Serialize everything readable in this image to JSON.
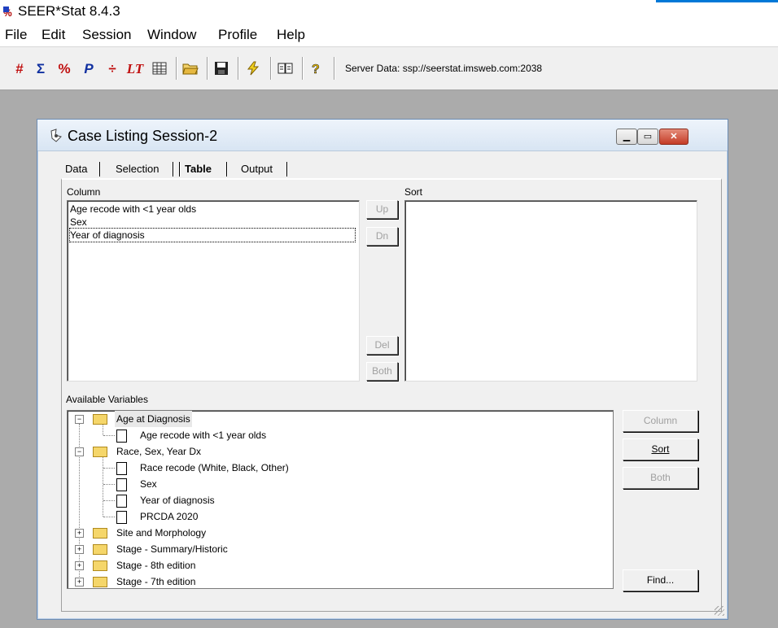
{
  "app": {
    "title": "SEER*Stat 8.4.3"
  },
  "menu": [
    "File",
    "Edit",
    "Session",
    "Window",
    "Profile",
    "Help"
  ],
  "toolbar": {
    "icons": [
      "#",
      "Σ",
      "%",
      "P",
      "÷",
      "LT"
    ],
    "server_text": "Server Data: ssp://seerstat.imsweb.com:2038"
  },
  "session": {
    "title": "Case Listing Session-2",
    "tabs": [
      "Data",
      "Selection",
      "Table",
      "Output"
    ],
    "active_tab": "Table"
  },
  "column": {
    "label": "Column",
    "items": [
      "Age recode with <1 year olds",
      "Sex",
      "Year of diagnosis"
    ]
  },
  "sort": {
    "label": "Sort"
  },
  "mid_buttons": {
    "up": "Up",
    "dn": "Dn",
    "del": "Del",
    "both": "Both"
  },
  "available": {
    "label": "Available Variables",
    "tree": [
      {
        "text": "Age at Diagnosis",
        "level": 0,
        "type": "folder",
        "expanded": true,
        "selected": true
      },
      {
        "text": "Age recode with <1 year olds",
        "level": 1,
        "type": "doc"
      },
      {
        "text": "Race, Sex, Year Dx",
        "level": 0,
        "type": "folder",
        "expanded": true
      },
      {
        "text": "Race recode (White, Black, Other)",
        "level": 1,
        "type": "doc"
      },
      {
        "text": "Sex",
        "level": 1,
        "type": "doc"
      },
      {
        "text": "Year of diagnosis",
        "level": 1,
        "type": "doc"
      },
      {
        "text": "PRCDA 2020",
        "level": 1,
        "type": "doc"
      },
      {
        "text": "Site and Morphology",
        "level": 0,
        "type": "folder",
        "expanded": false
      },
      {
        "text": "Stage - Summary/Historic",
        "level": 0,
        "type": "folder",
        "expanded": false
      },
      {
        "text": "Stage - 8th edition",
        "level": 0,
        "type": "folder",
        "expanded": false
      },
      {
        "text": "Stage - 7th edition",
        "level": 0,
        "type": "folder",
        "expanded": false
      }
    ]
  },
  "right_buttons": {
    "column": "Column",
    "sort": "Sort",
    "both": "Both",
    "find": "Find..."
  }
}
